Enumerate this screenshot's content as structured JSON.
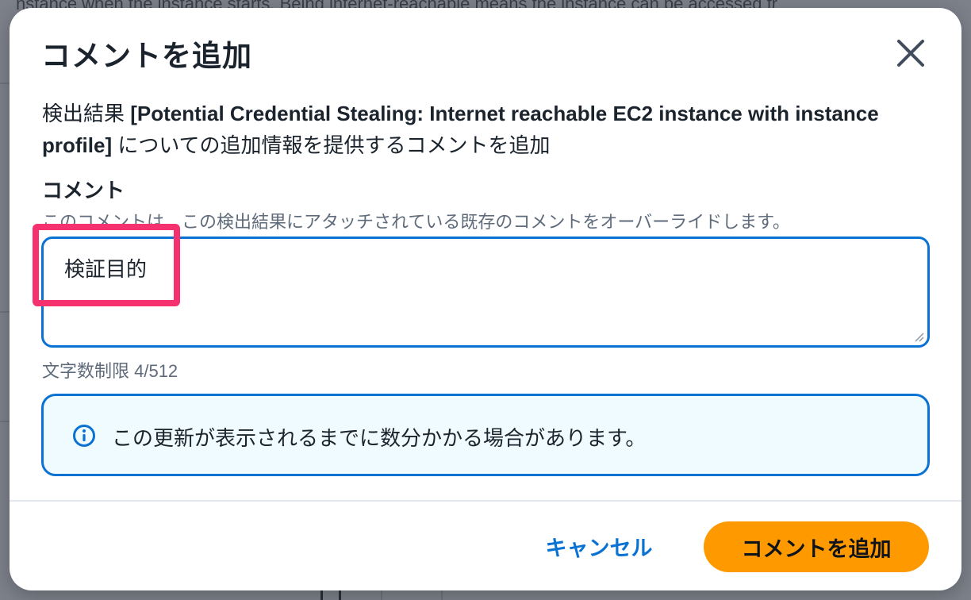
{
  "background": {
    "partial_text": "nstance when the instance starts. Being internet-reachable means the instance can be accessed fr"
  },
  "modal": {
    "title": "コメントを追加",
    "description_prefix": "検出結果 ",
    "finding_name": "[Potential Credential Stealing: Internet reachable EC2 instance with instance profile]",
    "description_suffix": " についての追加情報を提供するコメントを追加",
    "field_label": "コメント",
    "field_hint": "このコメントは、この検出結果にアタッチされている既存のコメントをオーバーライドします。",
    "comment_value": "検証目的",
    "char_limit": "文字数制限 4/512",
    "info_message": "この更新が表示されるまでに数分かかる場合があります。",
    "cancel_label": "キャンセル",
    "submit_label": "コメントを追加"
  },
  "colors": {
    "accent": "#0972d3",
    "primary_button": "#ff9900",
    "highlight": "#f5326f",
    "info_background": "#f0fbff"
  },
  "icons": {
    "close": "close-icon",
    "info": "info-icon",
    "resize": "resize-grip-icon"
  }
}
